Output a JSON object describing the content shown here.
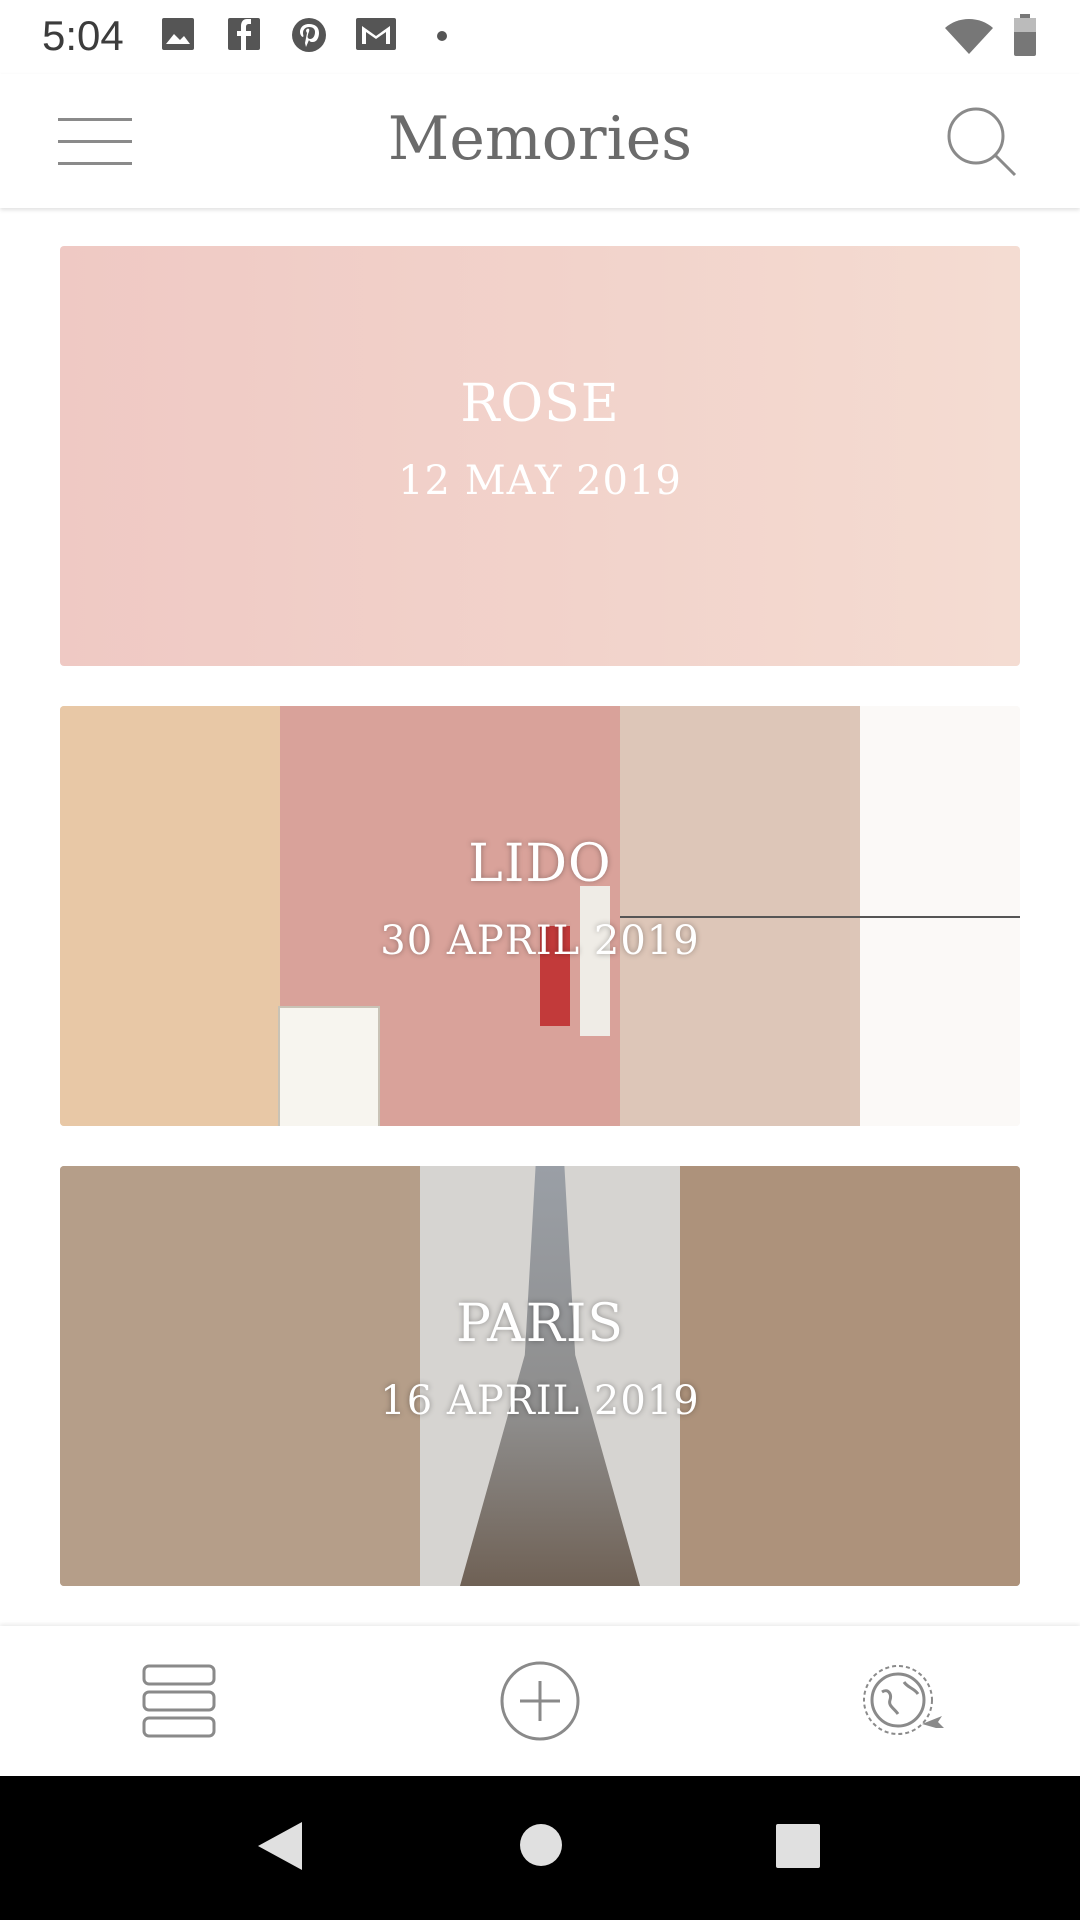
{
  "status_bar": {
    "time": "5:04",
    "icons": [
      "gallery-icon",
      "facebook-icon",
      "pinterest-icon",
      "gmail-icon",
      "notification-dot-icon",
      "wifi-icon",
      "battery-icon"
    ]
  },
  "app_bar": {
    "title": "Memories",
    "menu_icon": "hamburger-menu-icon",
    "search_icon": "search-icon"
  },
  "memories": [
    {
      "title": "ROSE",
      "date": "12 MAY 2019",
      "theme": "rose"
    },
    {
      "title": "LIDO",
      "date": "30 APRIL 2019",
      "theme": "lido"
    },
    {
      "title": "PARIS",
      "date": "16 APRIL 2019",
      "theme": "paris"
    }
  ],
  "bottom_bar": {
    "icons": [
      "list-view-icon",
      "add-icon",
      "globe-travel-icon"
    ]
  },
  "nav_bar": {
    "icons": [
      "back-icon",
      "home-icon",
      "recents-icon"
    ]
  },
  "colors": {
    "rose_card": "#efc9c4",
    "title_text": "#6b6b6b",
    "icon_gray": "#8a8a8a"
  }
}
